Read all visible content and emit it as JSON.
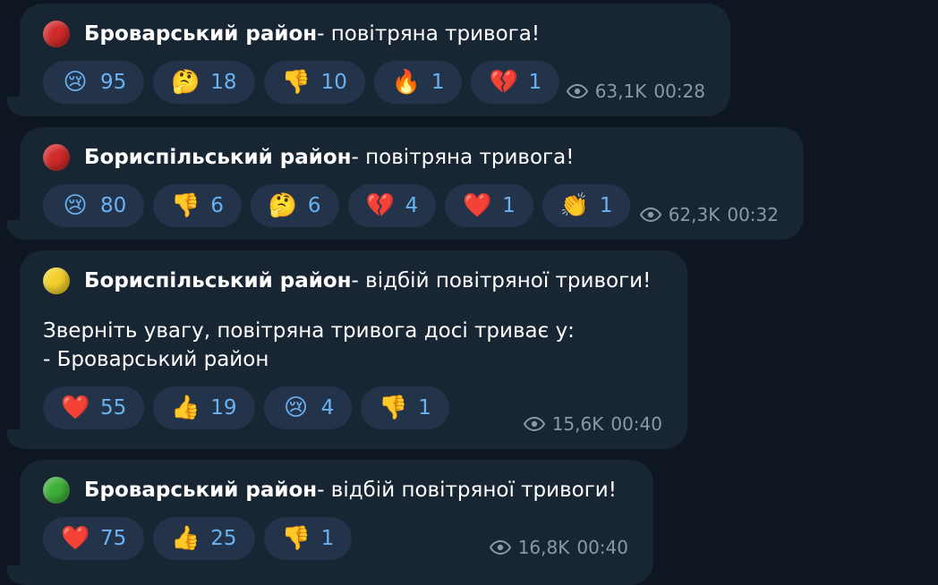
{
  "messages": [
    {
      "dot_color": "#d12a2a",
      "district": "Броварський район",
      "status": " - повітряна тривога!",
      "note": "",
      "reactions": [
        {
          "emoji": "😢",
          "count": "95"
        },
        {
          "emoji": "🤔",
          "count": "18"
        },
        {
          "emoji": "👎",
          "count": "10"
        },
        {
          "emoji": "🔥",
          "count": "1"
        },
        {
          "emoji": "💔",
          "count": "1"
        }
      ],
      "views": "63,1K",
      "time": "00:28"
    },
    {
      "dot_color": "#d12a2a",
      "district": "Бориспільський район",
      "status": " - повітряна тривога!",
      "note": "",
      "reactions": [
        {
          "emoji": "😢",
          "count": "80"
        },
        {
          "emoji": "👎",
          "count": "6"
        },
        {
          "emoji": "🤔",
          "count": "6"
        },
        {
          "emoji": "💔",
          "count": "4"
        },
        {
          "emoji": "❤️",
          "count": "1"
        },
        {
          "emoji": "👏",
          "count": "1"
        }
      ],
      "views": "62,3K",
      "time": "00:32"
    },
    {
      "dot_color": "#f3cf2c",
      "district": "Бориспільський район",
      "status": " - відбій повітряної тривоги!",
      "note": "Зверніть увагу, повітряна тривога досі триває у:\n- Броварський район",
      "reactions": [
        {
          "emoji": "❤️",
          "count": "55"
        },
        {
          "emoji": "👍",
          "count": "19"
        },
        {
          "emoji": "😢",
          "count": "4"
        },
        {
          "emoji": "👎",
          "count": "1"
        }
      ],
      "views": "15,6K",
      "time": "00:40"
    },
    {
      "dot_color": "#3fae3a",
      "district": "Броварський район",
      "status": " - відбій повітряної тривоги!",
      "note": "",
      "reactions": [
        {
          "emoji": "❤️",
          "count": "75"
        },
        {
          "emoji": "👍",
          "count": "25"
        },
        {
          "emoji": "👎",
          "count": "1"
        }
      ],
      "views": "16,8K",
      "time": "00:40"
    }
  ]
}
